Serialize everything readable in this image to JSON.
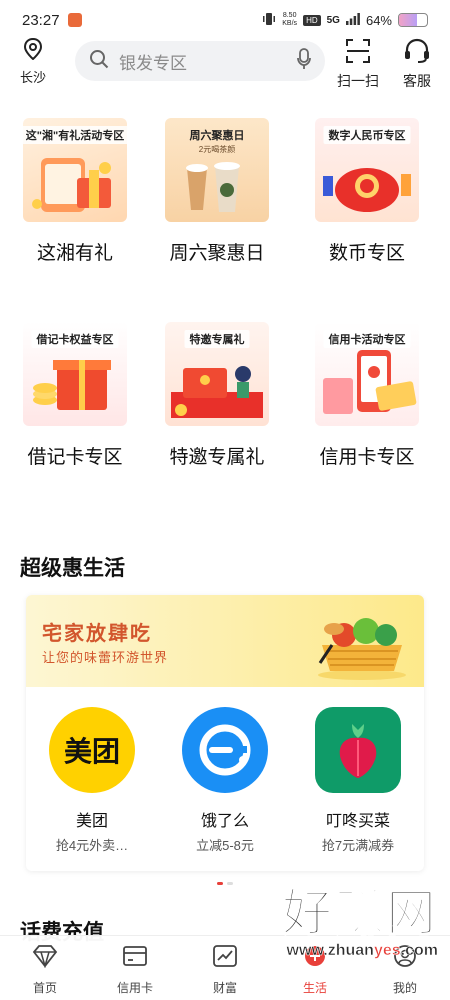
{
  "status_bar": {
    "time": "23:27",
    "net_speed": "8.50",
    "net_unit": "KB/s",
    "hd": "HD",
    "signal": "5G",
    "battery": "64%",
    "battery_level": 0.64
  },
  "header": {
    "location": "长沙",
    "search_placeholder": "银发专区",
    "scan_label": "扫一扫",
    "service_label": "客服"
  },
  "promos": [
    {
      "tag": "这\"湘\"有礼活动专区",
      "label": "这湘有礼"
    },
    {
      "tag": "周六聚惠日",
      "label": "周六聚惠日"
    },
    {
      "tag": "数字人民币专区",
      "label": "数币专区"
    },
    {
      "tag": "借记卡权益专区",
      "label": "借记卡专区"
    },
    {
      "tag": "特邀专属礼",
      "label": "特邀专属礼"
    },
    {
      "tag": "信用卡活动专区",
      "label": "信用卡专区"
    }
  ],
  "promo_sub": "2元喝茶颜",
  "section": {
    "title": "超级惠生活",
    "banner_title": "宅家放肆吃",
    "banner_subtitle": "让您的味蕾环游世界",
    "apps": [
      {
        "icon_text": "美团",
        "name": "美团",
        "desc": "抢4元外卖…"
      },
      {
        "icon_text": "e",
        "name": "饿了么",
        "desc": "立减5-8元"
      },
      {
        "icon_text": "",
        "name": "叮咚买菜",
        "desc": "抢7元满减券"
      }
    ]
  },
  "section2_title": "话费充值",
  "tabs": [
    {
      "label": "首页",
      "icon": "diamond-icon"
    },
    {
      "label": "信用卡",
      "icon": "card-icon"
    },
    {
      "label": "财富",
      "icon": "chart-icon"
    },
    {
      "label": "生活",
      "icon": "life-icon"
    },
    {
      "label": "我的",
      "icon": "user-icon"
    }
  ],
  "active_tab": "生活",
  "watermark": {
    "big": "好赚网",
    "small_prefix": "www.zhuan",
    "small_accent": "yes",
    "small_suffix": ".com"
  },
  "colors": {
    "accent": "#e8403a",
    "banner_text": "#d2562d",
    "meituan": "#ffd100",
    "eleme": "#1a8ff5",
    "dingdong": "#0f9b68"
  }
}
